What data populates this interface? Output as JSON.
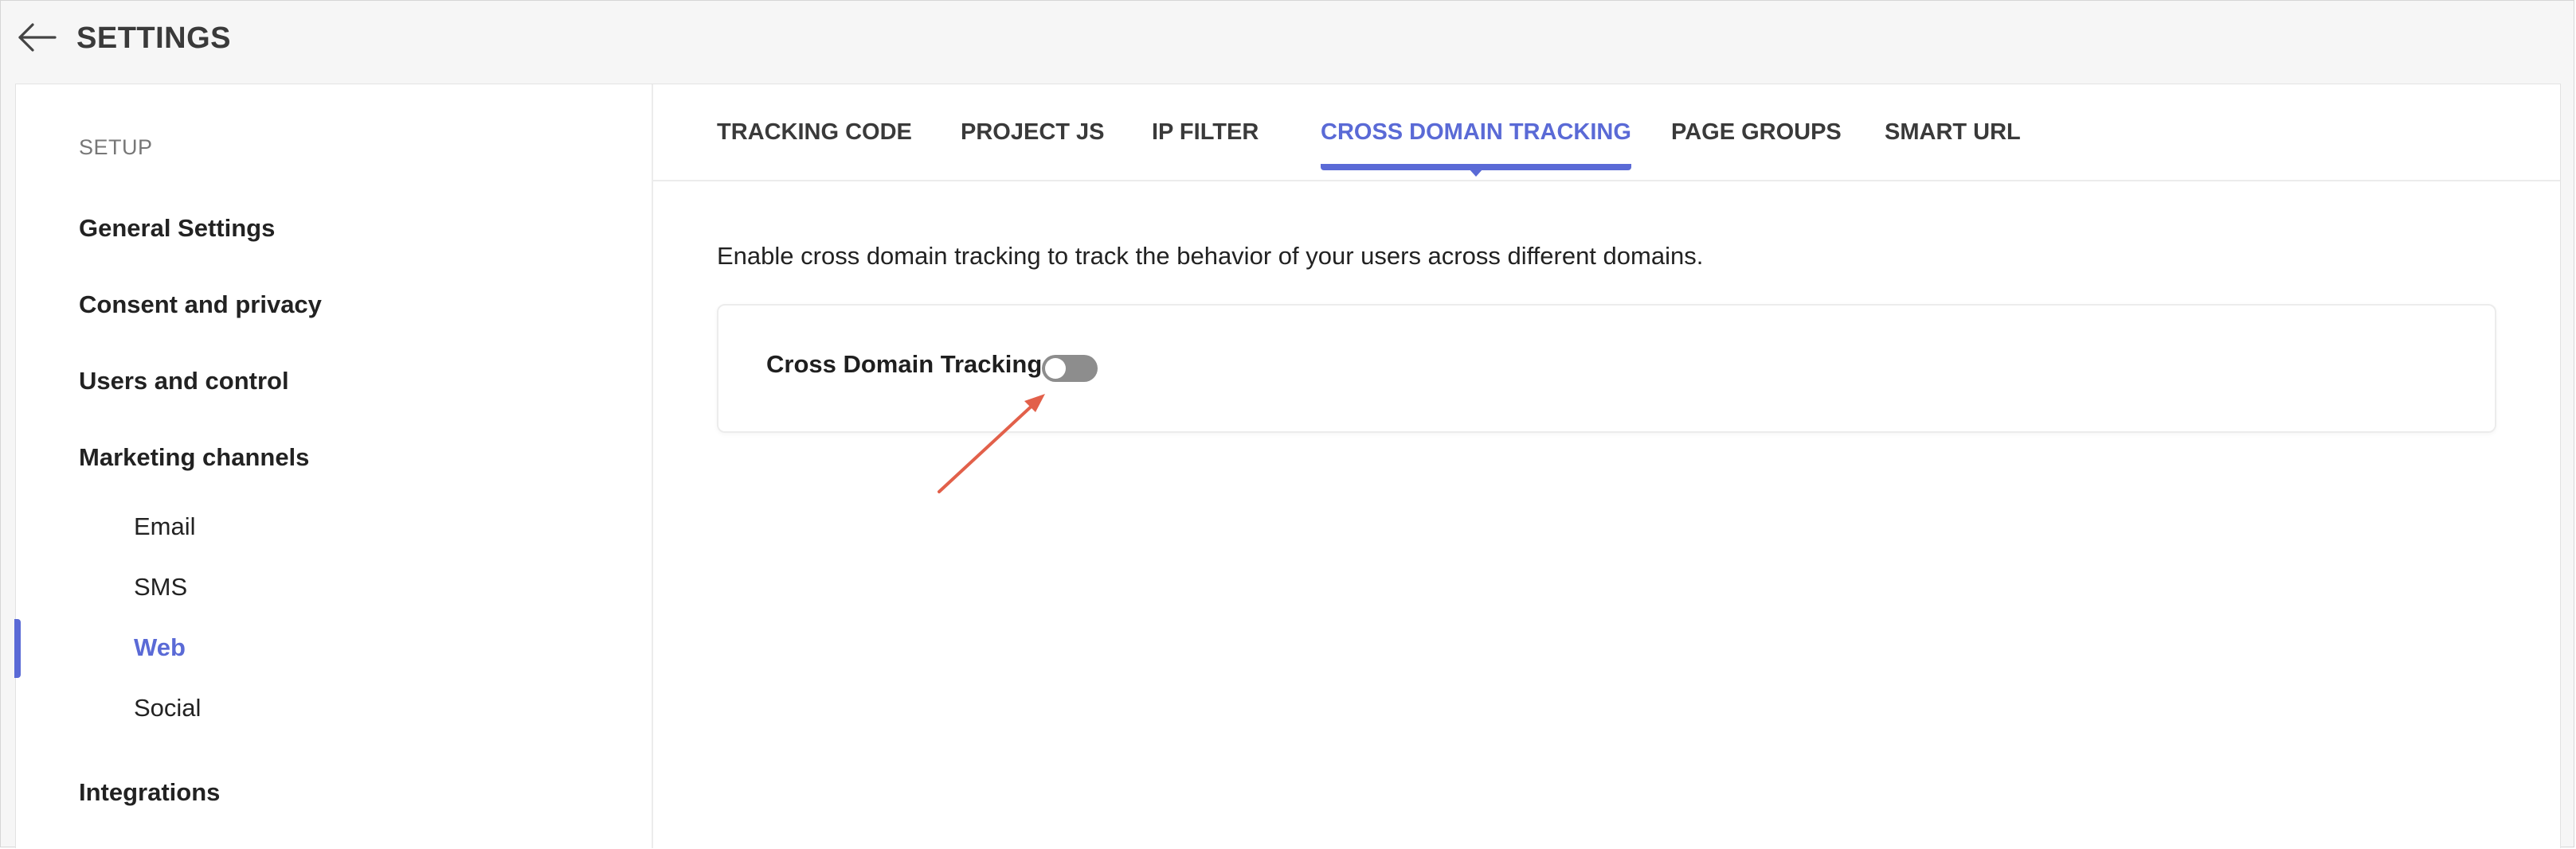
{
  "header": {
    "title": "SETTINGS",
    "back_icon": "arrow-left-icon"
  },
  "sidebar": {
    "section_label": "SETUP",
    "items": [
      {
        "label": "General Settings"
      },
      {
        "label": "Consent and privacy"
      },
      {
        "label": "Users and control"
      },
      {
        "label": "Marketing channels"
      },
      {
        "label": "Integrations"
      }
    ],
    "sub_items": [
      {
        "label": "Email",
        "active": false
      },
      {
        "label": "SMS",
        "active": false
      },
      {
        "label": "Web",
        "active": true
      },
      {
        "label": "Social",
        "active": false
      }
    ]
  },
  "tabs": [
    {
      "label": "TRACKING CODE",
      "active": false
    },
    {
      "label": "PROJECT JS",
      "active": false
    },
    {
      "label": "IP FILTER",
      "active": false
    },
    {
      "label": "CROSS DOMAIN TRACKING",
      "active": true
    },
    {
      "label": "PAGE GROUPS",
      "active": false
    },
    {
      "label": "SMART URL",
      "active": false
    }
  ],
  "main": {
    "description": "Enable cross domain tracking to track the behavior of your users across different domains.",
    "setting_label": "Cross Domain Tracking",
    "toggle_on": false
  },
  "colors": {
    "accent": "#5a6ad6",
    "toggle_off": "#8d8d8d",
    "annotation_arrow": "#e2604a"
  }
}
